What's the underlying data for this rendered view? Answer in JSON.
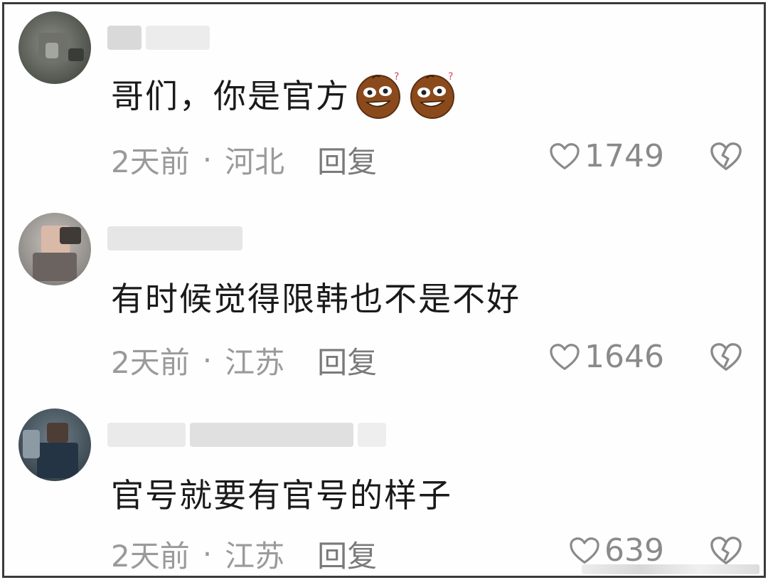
{
  "comments": [
    {
      "text": "哥们，你是官方",
      "emojis": [
        "thinking-face-emoji",
        "thinking-face-emoji"
      ],
      "time": "2天前",
      "separator": "·",
      "location": "河北",
      "reply_label": "回复",
      "likes": "1749"
    },
    {
      "text": "有时候觉得限韩也不是不好",
      "emojis": [],
      "time": "2天前",
      "separator": "·",
      "location": "江苏",
      "reply_label": "回复",
      "likes": "1646"
    },
    {
      "text": "官号就要有官号的样子",
      "emojis": [],
      "time": "2天前",
      "separator": "·",
      "location": "江苏",
      "reply_label": "回复",
      "likes": "639"
    }
  ],
  "colors": {
    "text": "#1a1a1a",
    "meta": "#9a9a9a",
    "icon": "#8a8a8a",
    "emoji_face": "#8b4a1c",
    "border": "#3a3a3a"
  },
  "icons": {
    "like": "heart-outline-icon",
    "dislike": "broken-heart-icon"
  }
}
